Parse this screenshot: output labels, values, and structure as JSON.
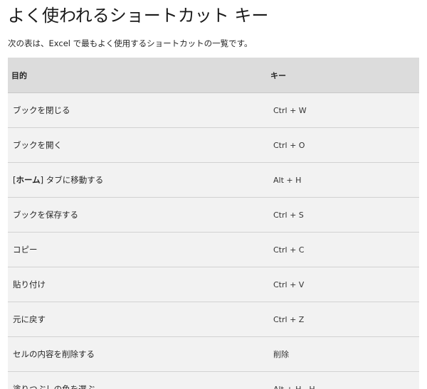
{
  "page": {
    "title": "よく使われるショートカット キー",
    "intro": "次の表は、Excel で最もよく使用するショートカットの一覧です。"
  },
  "table": {
    "headers": {
      "purpose": "目的",
      "key": "キー"
    },
    "rows": [
      {
        "purpose": "ブックを閉じる",
        "key": "Ctrl + W"
      },
      {
        "purpose": "ブックを開く",
        "key": "Ctrl + O"
      },
      {
        "purpose_prefix": "[",
        "purpose_bold": "ホーム",
        "purpose_suffix": "] タブに移動する",
        "key": "Alt + H"
      },
      {
        "purpose": "ブックを保存する",
        "key": "Ctrl + S"
      },
      {
        "purpose": "コピー",
        "key": "Ctrl + C"
      },
      {
        "purpose": "貼り付け",
        "key": "Ctrl + V"
      },
      {
        "purpose": "元に戻す",
        "key": "Ctrl + Z"
      },
      {
        "purpose": "セルの内容を削除する",
        "key": "削除"
      },
      {
        "purpose": "塗りつぶしの色を選ぶ",
        "key": "Alt + H、H"
      }
    ]
  }
}
